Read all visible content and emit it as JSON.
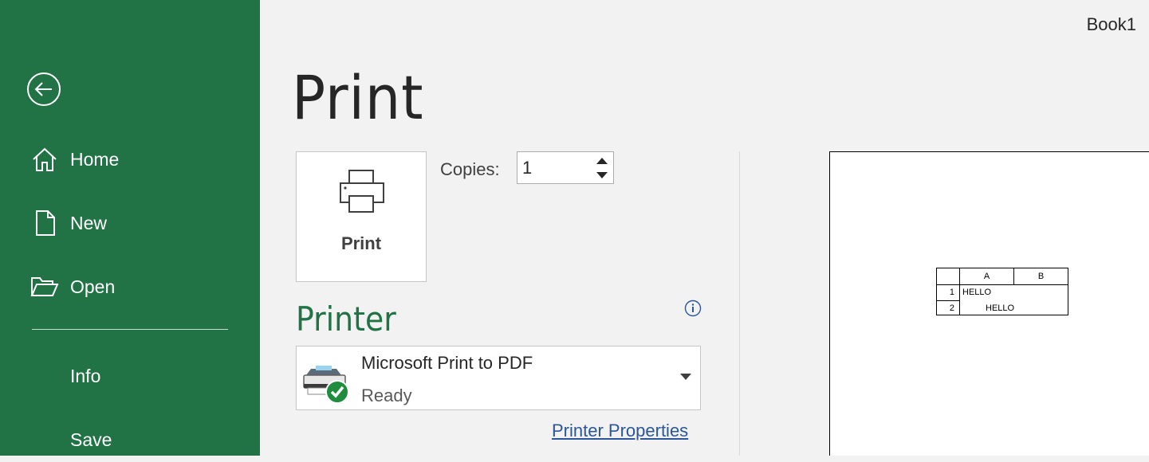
{
  "window": {
    "doc_title": "Book1"
  },
  "sidebar": {
    "bg_color": "#217346",
    "back_icon": "back-arrow-circle-icon",
    "items_top": [
      {
        "label": "Home",
        "icon": "home-icon"
      },
      {
        "label": "New",
        "icon": "new-document-icon"
      },
      {
        "label": "Open",
        "icon": "open-folder-icon"
      }
    ],
    "items_bottom": [
      {
        "label": "Info"
      },
      {
        "label": "Save"
      }
    ]
  },
  "main": {
    "page_title": "Print",
    "print_button_label": "Print",
    "copies": {
      "label": "Copies:",
      "value": "1"
    },
    "printer_section": {
      "heading": "Printer",
      "selected_name": "Microsoft Print to PDF",
      "selected_status": "Ready",
      "properties_link": "Printer Properties"
    }
  },
  "preview": {
    "columns": [
      "A",
      "B"
    ],
    "rows": [
      {
        "num": "1",
        "a": "HELLO"
      },
      {
        "num": "2",
        "a": "HELLO"
      }
    ]
  }
}
